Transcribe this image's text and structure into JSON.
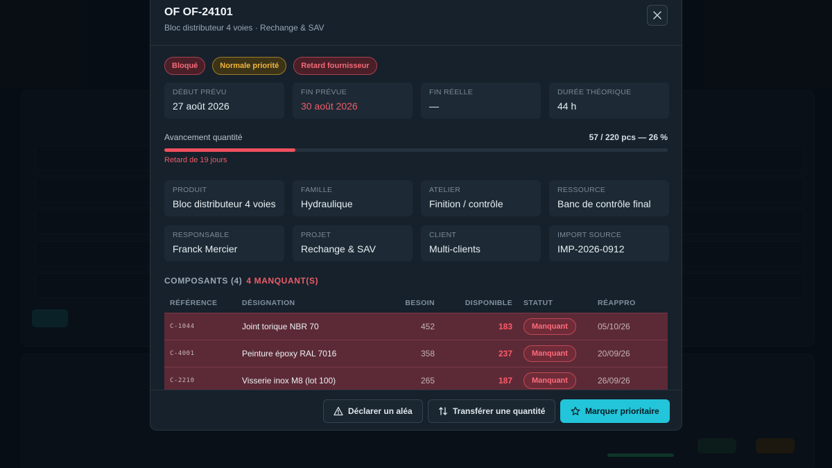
{
  "modal": {
    "title": "OF OF-24101",
    "subtitle": "Bloc distributeur 4 voies · Rechange & SAV",
    "badges": [
      {
        "label": "Bloqué",
        "tone": "#f26b78"
      },
      {
        "label": "Normale priorité",
        "tone": "#f0b63a"
      },
      {
        "label": "Retard fournisseur",
        "tone": "#f26b78"
      }
    ],
    "dates": [
      {
        "label": "Début prévu",
        "value": "27 août 2026"
      },
      {
        "label": "Fin prévue",
        "value": "30 août 2026"
      },
      {
        "label": "Fin réelle",
        "value": "—"
      },
      {
        "label": "Durée théorique",
        "value": "44 h"
      }
    ],
    "progress": {
      "label": "Avancement quantité",
      "value_text": "57 / 220 pcs — 26 %",
      "fraction": 0.26,
      "note": "Retard de 19 jours"
    },
    "info": [
      {
        "label": "Produit",
        "value": "Bloc distributeur 4 voies"
      },
      {
        "label": "Famille",
        "value": "Hydraulique"
      },
      {
        "label": "Atelier",
        "value": "Finition / contrôle"
      },
      {
        "label": "Ressource",
        "value": "Banc de contrôle final"
      },
      {
        "label": "Responsable",
        "value": "Franck Mercier"
      },
      {
        "label": "Projet",
        "value": "Rechange & SAV"
      },
      {
        "label": "Client",
        "value": "Multi-clients"
      },
      {
        "label": "Import source",
        "value": "IMP-2026-0912"
      }
    ],
    "components": {
      "title": "COMPOSANTS (4)",
      "missing": "4 MANQUANT(S)",
      "headers": [
        "RÉFÉRENCE",
        "DÉSIGNATION",
        "BESOIN",
        "DISPONIBLE",
        "STATUT",
        "RÉAPPRO"
      ],
      "rows": [
        {
          "ref": "C-1044",
          "name": "Joint torique NBR 70",
          "need": "452",
          "available": "183",
          "status": "Manquant",
          "restock": "05/10/26"
        },
        {
          "ref": "C-4001",
          "name": "Peinture époxy RAL 7016",
          "need": "358",
          "available": "237",
          "status": "Manquant",
          "restock": "20/09/26"
        },
        {
          "ref": "C-2210",
          "name": "Visserie inox M8 (lot 100)",
          "need": "265",
          "available": "187",
          "status": "Manquant",
          "restock": "26/09/26"
        }
      ]
    },
    "footer": {
      "declare": "Déclarer un aléa",
      "transfer": "Transférer une quantité",
      "priority": "Marquer prioritaire"
    }
  },
  "colors": {
    "accent": "#22c5d9",
    "danger": "#f05b68",
    "warning": "#f0b63a"
  }
}
